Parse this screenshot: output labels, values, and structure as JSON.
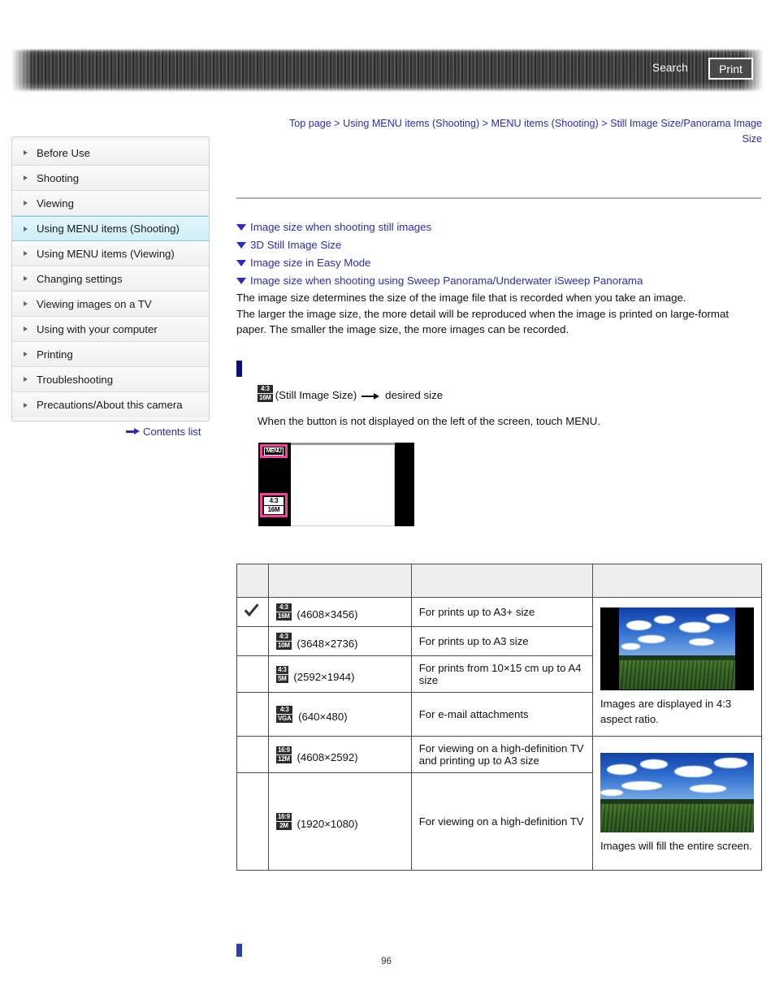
{
  "header": {
    "search_label": "Search",
    "print_label": "Print"
  },
  "breadcrumb": {
    "items": [
      "Top page",
      "Using MENU items (Shooting)",
      "MENU items (Shooting)",
      "Still Image Size/Panorama Image Size"
    ],
    "separator": ">"
  },
  "sidebar": {
    "items": [
      {
        "label": "Before Use"
      },
      {
        "label": "Shooting"
      },
      {
        "label": "Viewing"
      },
      {
        "label": "Using MENU items (Shooting)"
      },
      {
        "label": "Using MENU items (Viewing)"
      },
      {
        "label": "Changing settings"
      },
      {
        "label": "Viewing images on a TV"
      },
      {
        "label": "Using with your computer"
      },
      {
        "label": "Printing"
      },
      {
        "label": "Troubleshooting"
      },
      {
        "label": "Precautions/About this camera"
      }
    ],
    "active_index": 3,
    "contents_list_label": "Contents list"
  },
  "main": {
    "toc_links": [
      "Image size when shooting still images",
      "3D Still Image Size",
      "Image size in Easy Mode",
      "Image size when shooting using Sweep Panorama/Underwater iSweep Panorama"
    ],
    "intro_line1": "The image size determines the size of the image file that is recorded when you take an image.",
    "intro_line2": "The larger the image size, the more detail will be reproduced when the image is printed on large-format",
    "intro_line3": "paper. The smaller the image size, the more images can be recorded.",
    "step": {
      "badge_top": "4:3",
      "badge_bottom": "16M",
      "label": "(Still Image Size)",
      "target": "desired size",
      "note": "When the button is not displayed on the left of the screen, touch MENU."
    },
    "camera_screen": {
      "menu_button_label": "MENU",
      "size_button_top": "4:3",
      "size_button_bottom": "16M"
    }
  },
  "table": {
    "headers": [
      "",
      "",
      "",
      ""
    ],
    "rows": [
      {
        "checked": true,
        "badge_top": "4:3",
        "badge_bottom": "16M",
        "dimensions": "(4608×3456)",
        "description": "For prints up to A3+ size"
      },
      {
        "checked": false,
        "badge_top": "4:3",
        "badge_bottom": "10M",
        "dimensions": "(3648×2736)",
        "description": "For prints up to A3 size"
      },
      {
        "checked": false,
        "badge_top": "4:3",
        "badge_bottom": "5M",
        "dimensions": "(2592×1944)",
        "description": "For prints from 10×15 cm up to A4 size"
      },
      {
        "checked": false,
        "badge_top": "4:3",
        "badge_bottom": "VGA",
        "dimensions": "(640×480)",
        "description": "For e-mail attachments"
      },
      {
        "checked": false,
        "badge_top": "16:9",
        "badge_bottom": "12M",
        "dimensions": "(4608×2592)",
        "description": "For viewing on a high-definition TV and printing up to A3 size"
      },
      {
        "checked": false,
        "badge_top": "16:9",
        "badge_bottom": "2M",
        "dimensions": "(1920×1080)",
        "description": "For viewing on a high-definition TV"
      }
    ],
    "caption_43": "Images are displayed in 4:3 aspect ratio.",
    "caption_169": "Images will fill the entire screen."
  },
  "footer": {
    "page_number": "96"
  },
  "colors": {
    "link": "#2b2bc0",
    "accent_marker": "#0a0a8c",
    "highlight_pink": "#ff3e9a",
    "sidebar_active": "#cfeef7"
  }
}
